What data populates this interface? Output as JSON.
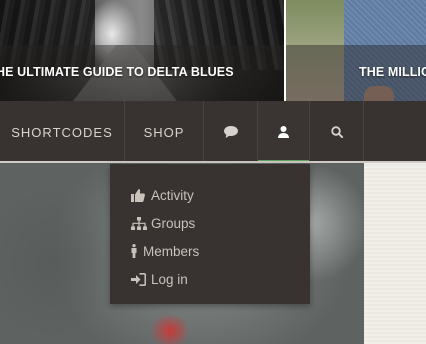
{
  "featured": [
    {
      "title": "HE ULTIMATE GUIDE TO DELTA BLUES"
    },
    {
      "title": "THE MILLIC"
    }
  ],
  "nav": {
    "items": [
      {
        "label": "SHORTCODES"
      },
      {
        "label": "SHOP"
      }
    ],
    "icons": [
      "chat-icon",
      "user-icon",
      "search-icon"
    ],
    "active_accent": "#5fa65f"
  },
  "dropdown": {
    "items": [
      {
        "label": "Activity",
        "icon": "thumbs-up-icon"
      },
      {
        "label": "Groups",
        "icon": "sitemap-icon"
      },
      {
        "label": "Members",
        "icon": "person-icon"
      },
      {
        "label": "Log in",
        "icon": "sign-in-icon"
      }
    ]
  },
  "colors": {
    "navbar": "#383330",
    "dropdown_text": "#c8c2bb",
    "accent": "#5fa65f"
  }
}
